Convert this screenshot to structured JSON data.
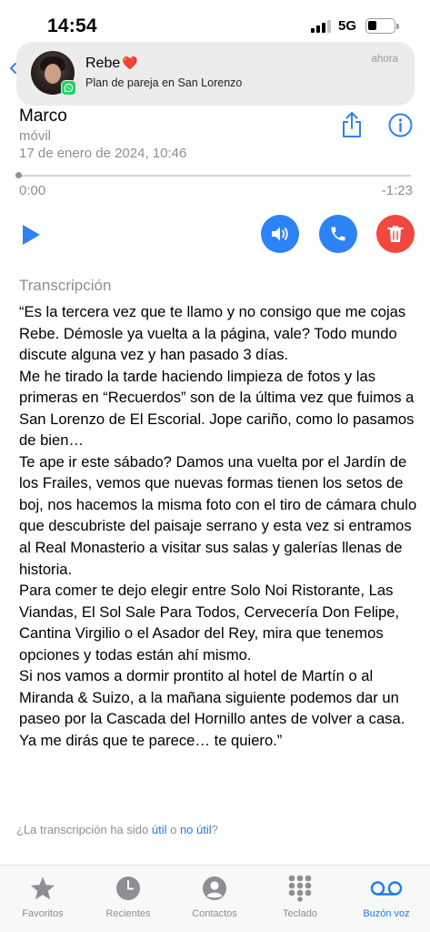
{
  "status_bar": {
    "time": "14:54",
    "network": "5G"
  },
  "notification": {
    "sender": "Rebe",
    "emoji": "❤️",
    "message": "Plan de pareja en San Lorenzo",
    "time": "ahora",
    "app_icon": "whatsapp-icon"
  },
  "voicemail": {
    "caller": "Marco",
    "type": "móvil",
    "date": "17 de enero de 2024, 10:46",
    "elapsed": "0:00",
    "remaining": "-1:23",
    "progress": 0
  },
  "transcription": {
    "label": "Transcripción",
    "text": "“Es la tercera vez que te llamo y no consigo que me cojas Rebe. Démosle ya vuelta a la página, vale? Todo mundo discute alguna vez y han pasado 3 días.\nMe he tirado la tarde haciendo limpieza de fotos y las primeras en “Recuerdos” son de la última vez que fuimos a San Lorenzo de El Escorial. Jope cariño, como lo pasamos de bien…\nTe ape ir este sábado? Damos una vuelta por el Jardín de los Frailes, vemos que nuevas formas tienen los setos de boj, nos hacemos la misma foto con el tiro de cámara chulo que descubriste del paisaje serrano y esta vez si entramos al Real Monasterio a visitar sus salas y galerías llenas de historia.\nPara comer te dejo elegir entre Solo Noi Ristorante, Las Viandas, El Sol Sale Para Todos, Cervecería Don Felipe, Cantina Virgilio o el Asador del Rey, mira que tenemos opciones y todas están ahí mismo.\nSi nos vamos a dormir prontito al hotel de Martín o al Miranda & Suizo, a la mañana siguiente podemos dar un paseo por la Cascada del Hornillo antes de volver a casa.\nYa me dirás que te parece… te quiero.”",
    "feedback_prefix": "¿La transcripción ha sido ",
    "feedback_useful": "útil",
    "feedback_or": " o ",
    "feedback_not_useful": "no útil",
    "feedback_suffix": "?"
  },
  "tabs": [
    {
      "label": "Favoritos",
      "icon": "star-icon"
    },
    {
      "label": "Recientes",
      "icon": "clock-icon"
    },
    {
      "label": "Contactos",
      "icon": "person-icon"
    },
    {
      "label": "Teclado",
      "icon": "keypad-icon"
    },
    {
      "label": "Buzón voz",
      "icon": "voicemail-icon"
    }
  ],
  "active_tab": "Buzón voz",
  "colors": {
    "accent": "#2d82f5",
    "delete": "#f0483e",
    "secondary_text": "#8e8e93"
  }
}
